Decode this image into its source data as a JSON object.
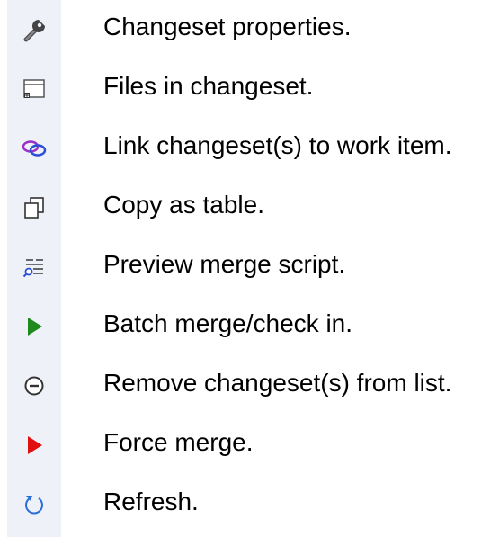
{
  "legend": {
    "items": [
      {
        "icon": "wrench-icon",
        "label": "Changeset properties."
      },
      {
        "icon": "window-files-icon",
        "label": "Files in changeset."
      },
      {
        "icon": "link-icon",
        "label": "Link changeset(s) to work item."
      },
      {
        "icon": "copy-icon",
        "label": "Copy as table."
      },
      {
        "icon": "preview-script-icon",
        "label": "Preview merge script."
      },
      {
        "icon": "play-green-icon",
        "label": "Batch merge/check in."
      },
      {
        "icon": "remove-circle-icon",
        "label": "Remove changeset(s) from list."
      },
      {
        "icon": "play-red-icon",
        "label": "Force merge."
      },
      {
        "icon": "refresh-icon",
        "label": "Refresh."
      }
    ]
  },
  "colors": {
    "strip_background": "#eef1f8",
    "batch_merge_green": "#1e8a1e",
    "force_merge_red": "#e01010",
    "link_blue": "#2b4fd6",
    "link_purple": "#9b30c8",
    "refresh_blue": "#2a6fd6"
  }
}
